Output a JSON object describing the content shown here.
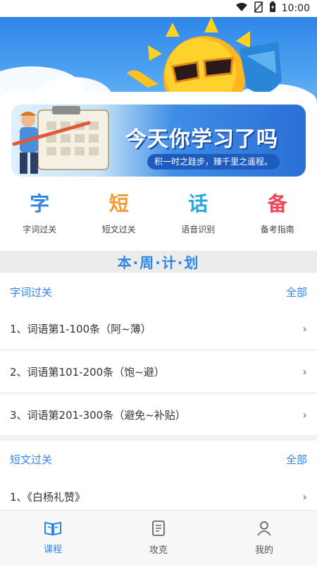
{
  "status_bar": {
    "time": "10:00"
  },
  "banner": {
    "title": "今天你学习了吗",
    "subtitle": "积一时之跬步，臻千里之遥程。"
  },
  "categories": [
    {
      "char": "字",
      "label": "字词过关",
      "color": "#2f86e8"
    },
    {
      "char": "短",
      "label": "短文过关",
      "color": "#f39a3a"
    },
    {
      "char": "话",
      "label": "语音识别",
      "color": "#29a8d9"
    },
    {
      "char": "备",
      "label": "备考指南",
      "color": "#e9495b"
    }
  ],
  "week_plan": {
    "title": "本·周·计·划"
  },
  "sections": [
    {
      "title": "字词过关",
      "more": "全部",
      "items": [
        "1、词语第1-100条（阿~薄）",
        "2、词语第101-200条（饱~避）",
        "3、词语第201-300条（避免~补贴）"
      ]
    },
    {
      "title": "短文过关",
      "more": "全部",
      "items": [
        "1、《白杨礼赞》"
      ]
    }
  ],
  "bottom_nav": [
    {
      "label": "课程",
      "icon": "book-icon",
      "active": true
    },
    {
      "label": "攻克",
      "icon": "scroll-icon",
      "active": false
    },
    {
      "label": "我的",
      "icon": "user-icon",
      "active": false
    }
  ],
  "colors": {
    "accent": "#2f86e8",
    "sky": "#4fa3f2"
  }
}
